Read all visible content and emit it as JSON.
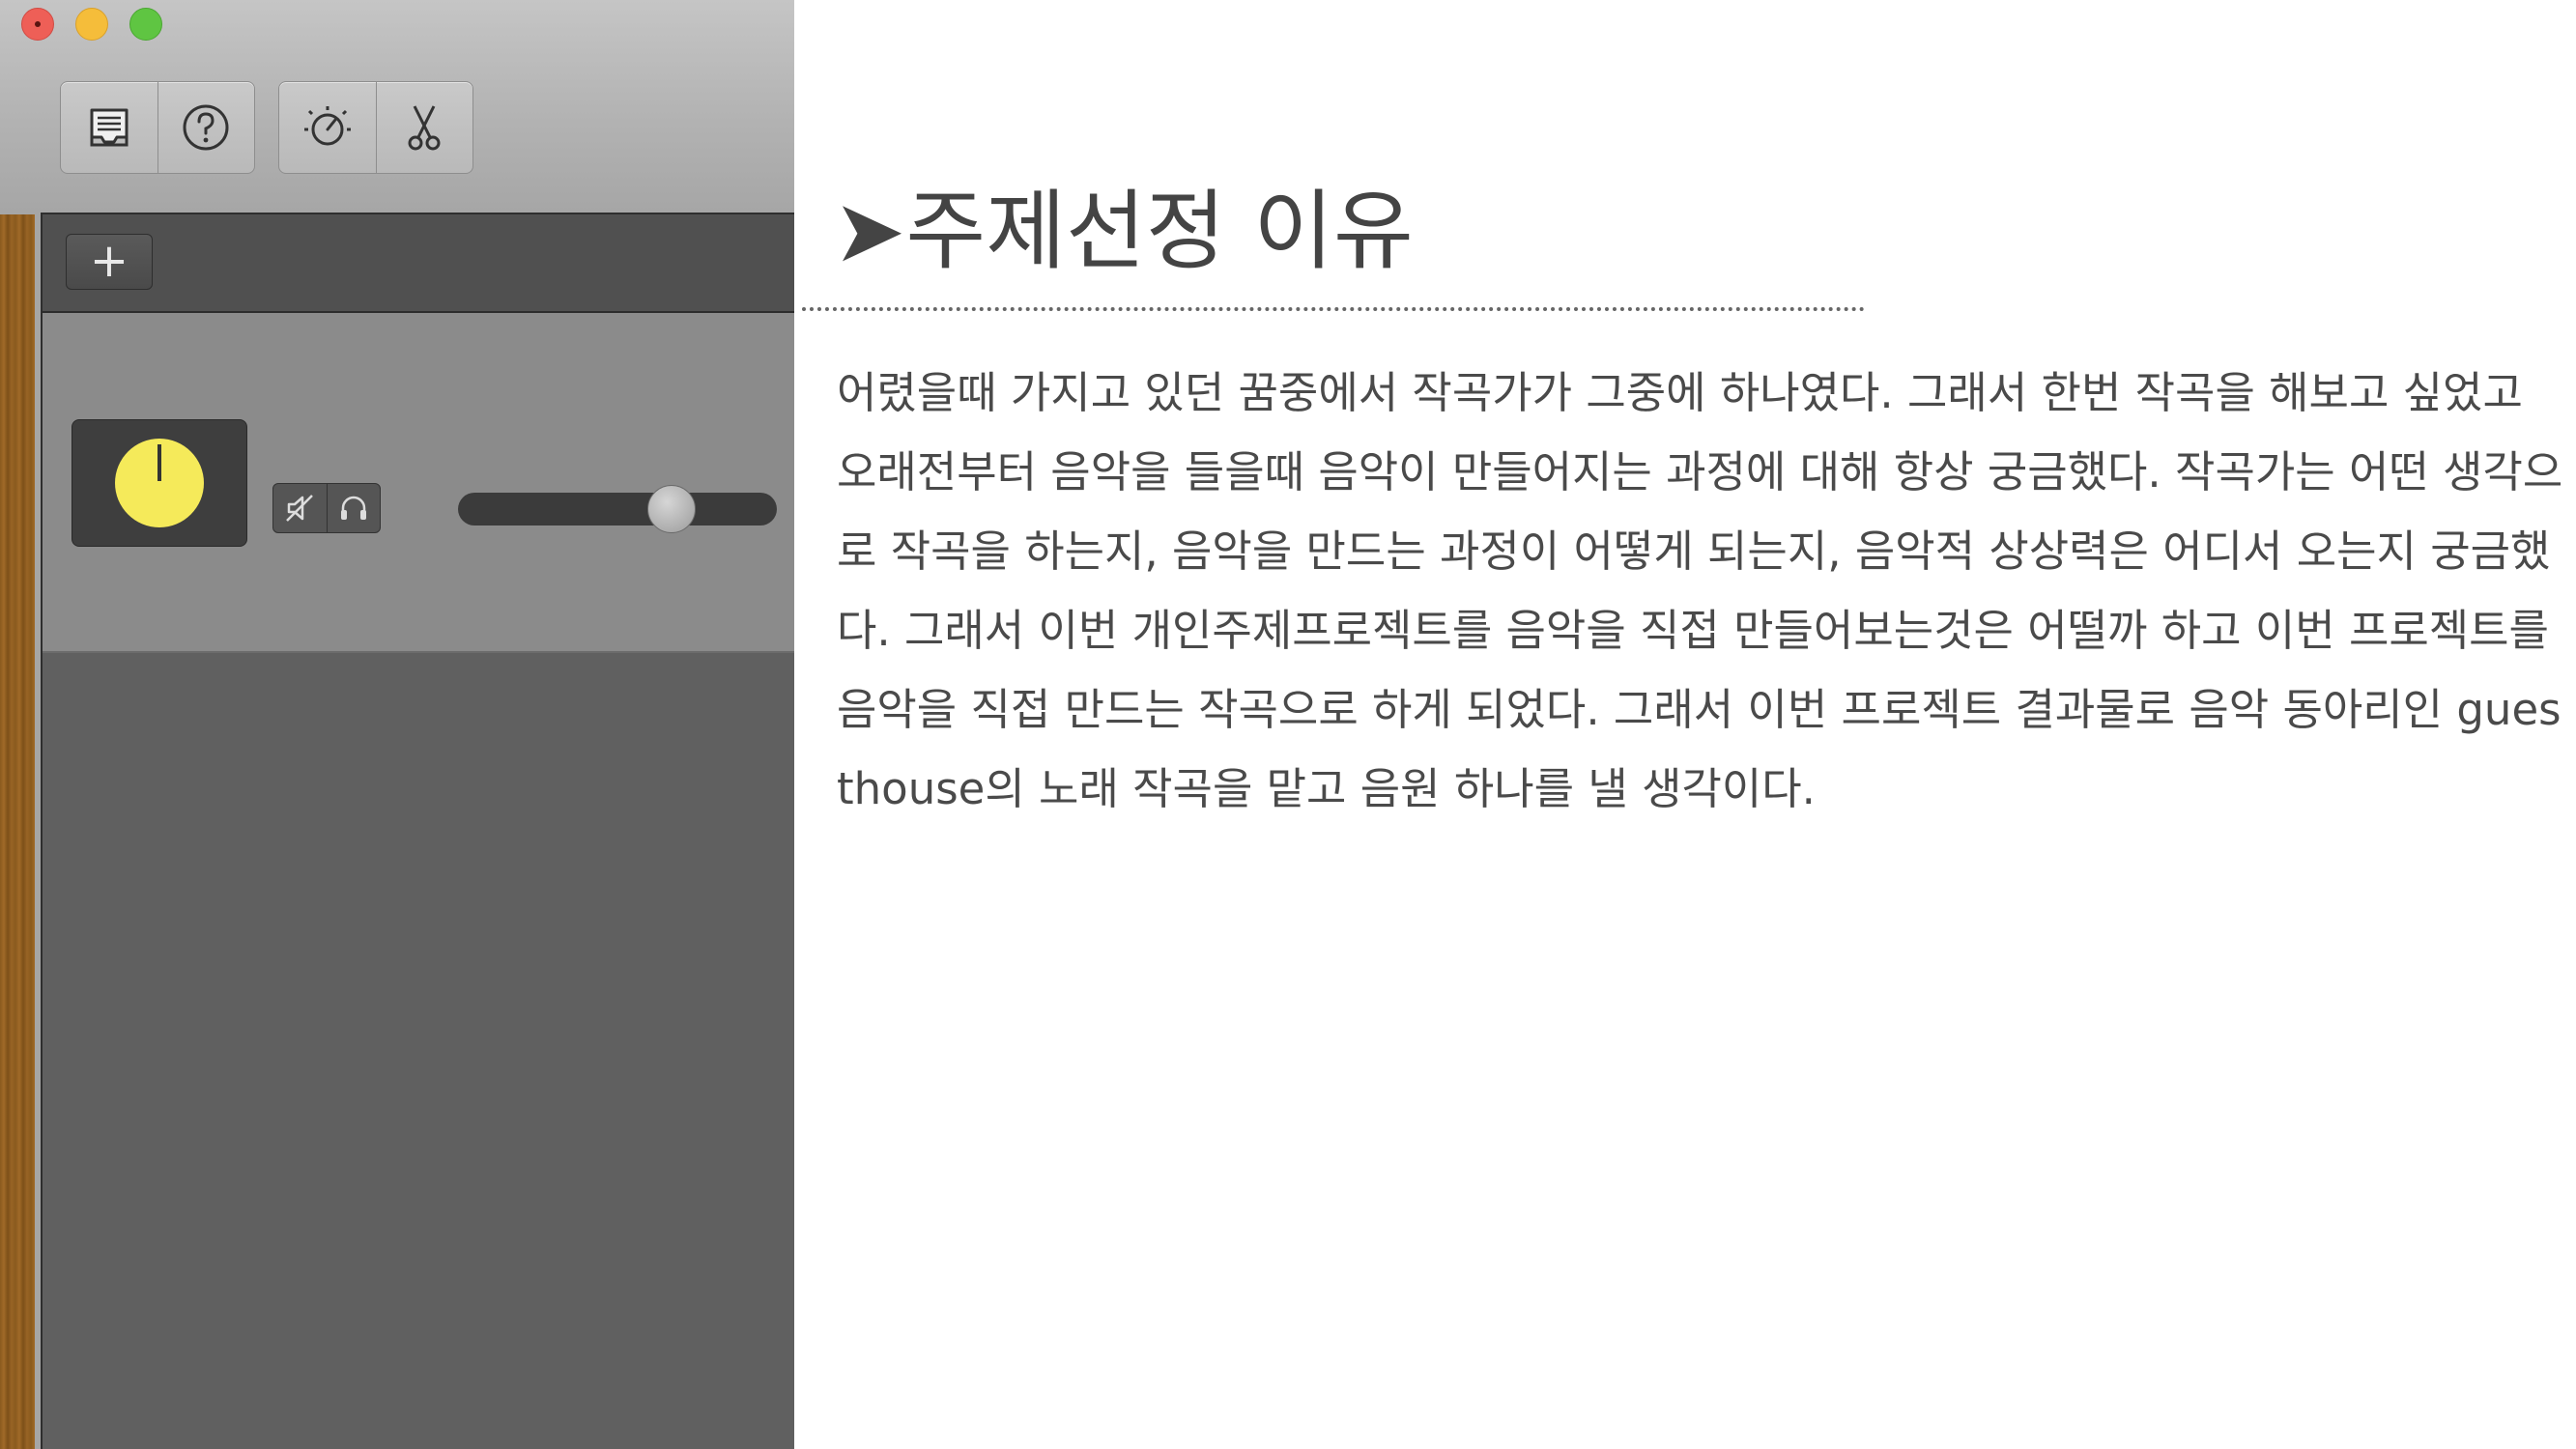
{
  "window": {
    "traffic_lights": [
      "close",
      "minimize",
      "maximize"
    ]
  },
  "toolbar": {
    "groups": [
      {
        "items": [
          {
            "icon": "library-inbox-icon"
          },
          {
            "icon": "help-icon"
          }
        ]
      },
      {
        "items": [
          {
            "icon": "smart-controls-icon"
          },
          {
            "icon": "scissors-icon"
          }
        ]
      }
    ]
  },
  "tracks": {
    "add_label": "+",
    "rows": [
      {
        "icon": "yellow-knob-icon",
        "controls": [
          "mute-icon",
          "headphones-icon"
        ],
        "volume_fraction": 0.7
      }
    ]
  },
  "document": {
    "title": "➤주제선정 이유",
    "paragraph": "어렸을때 가지고 있던 꿈중에서 작곡가가 그중에 하나였다. 그래서 한번 작곡을 해보고 싶었고 오래전부터 음악을 들을때 음악이 만들어지는 과정에 대해 항상 궁금했다. 작곡가는 어떤 생각으로 작곡을 하는지, 음악을 만드는 과정이 어떻게 되는지, 음악적 상상력은 어디서 오는지 궁금했다. 그래서 이번 개인주제프로젝트를 음악을 직접 만들어보는것은 어떨까 하고 이번 프로젝트를 음악을 직접 만드는 작곡으로 하게 되었다. 그래서 이번 프로젝트 결과물로 음악 동아리인 guesthouse의 노래 작곡을 맡고 음원 하나를 낼 생각이다."
  },
  "colors": {
    "panel_bg": "#a6a6a6",
    "track_bg": "#606060",
    "knob": "#f5ea5a",
    "text": "#4a4a4a"
  }
}
